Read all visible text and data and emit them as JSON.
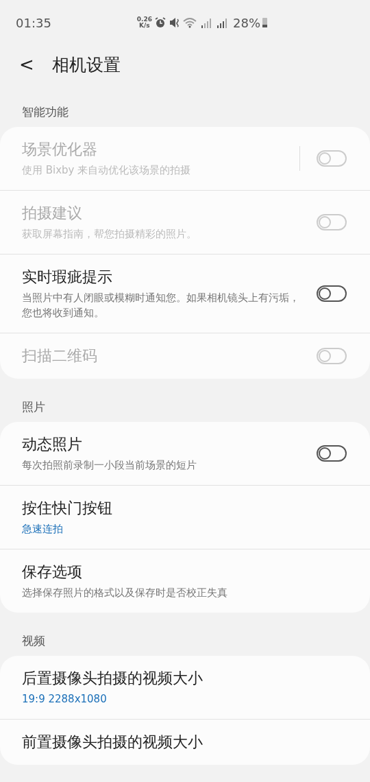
{
  "status_bar": {
    "time": "01:35",
    "speed": "0.26\nK/s",
    "battery_text": "28%"
  },
  "header": {
    "back": "<",
    "title": "相机设置"
  },
  "sections": [
    {
      "title": "智能功能",
      "items": [
        {
          "kind": "switch",
          "title": "场景优化器",
          "description": "使用 Bixby 来自动优化该场景的拍摄",
          "disabled": true,
          "on": false,
          "divider": true
        },
        {
          "kind": "switch",
          "title": "拍摄建议",
          "description": "获取屏幕指南，帮您拍摄精彩的照片。",
          "disabled": true,
          "on": false
        },
        {
          "kind": "switch",
          "title": "实时瑕疵提示",
          "description": "当照片中有人闭眼或模糊时通知您。如果相机镜头上有污垢，您也将收到通知。",
          "disabled": false,
          "on": false
        },
        {
          "kind": "switch",
          "title": "扫描二维码",
          "disabled": true,
          "on": false
        }
      ]
    },
    {
      "title": "照片",
      "items": [
        {
          "kind": "switch",
          "title": "动态照片",
          "description": "每次拍照前录制一小段当前场景的短片",
          "disabled": false,
          "on": false
        },
        {
          "kind": "link",
          "title": "按住快门按钮",
          "value": "急速连拍"
        },
        {
          "kind": "link",
          "title": "保存选项",
          "description": "选择保存照片的格式以及保存时是否校正失真"
        }
      ]
    },
    {
      "title": "视频",
      "items": [
        {
          "kind": "link",
          "title": "后置摄像头拍摄的视频大小",
          "value": "19:9 2288x1080"
        },
        {
          "kind": "link",
          "title": "前置摄像头拍摄的视频大小"
        }
      ]
    }
  ]
}
